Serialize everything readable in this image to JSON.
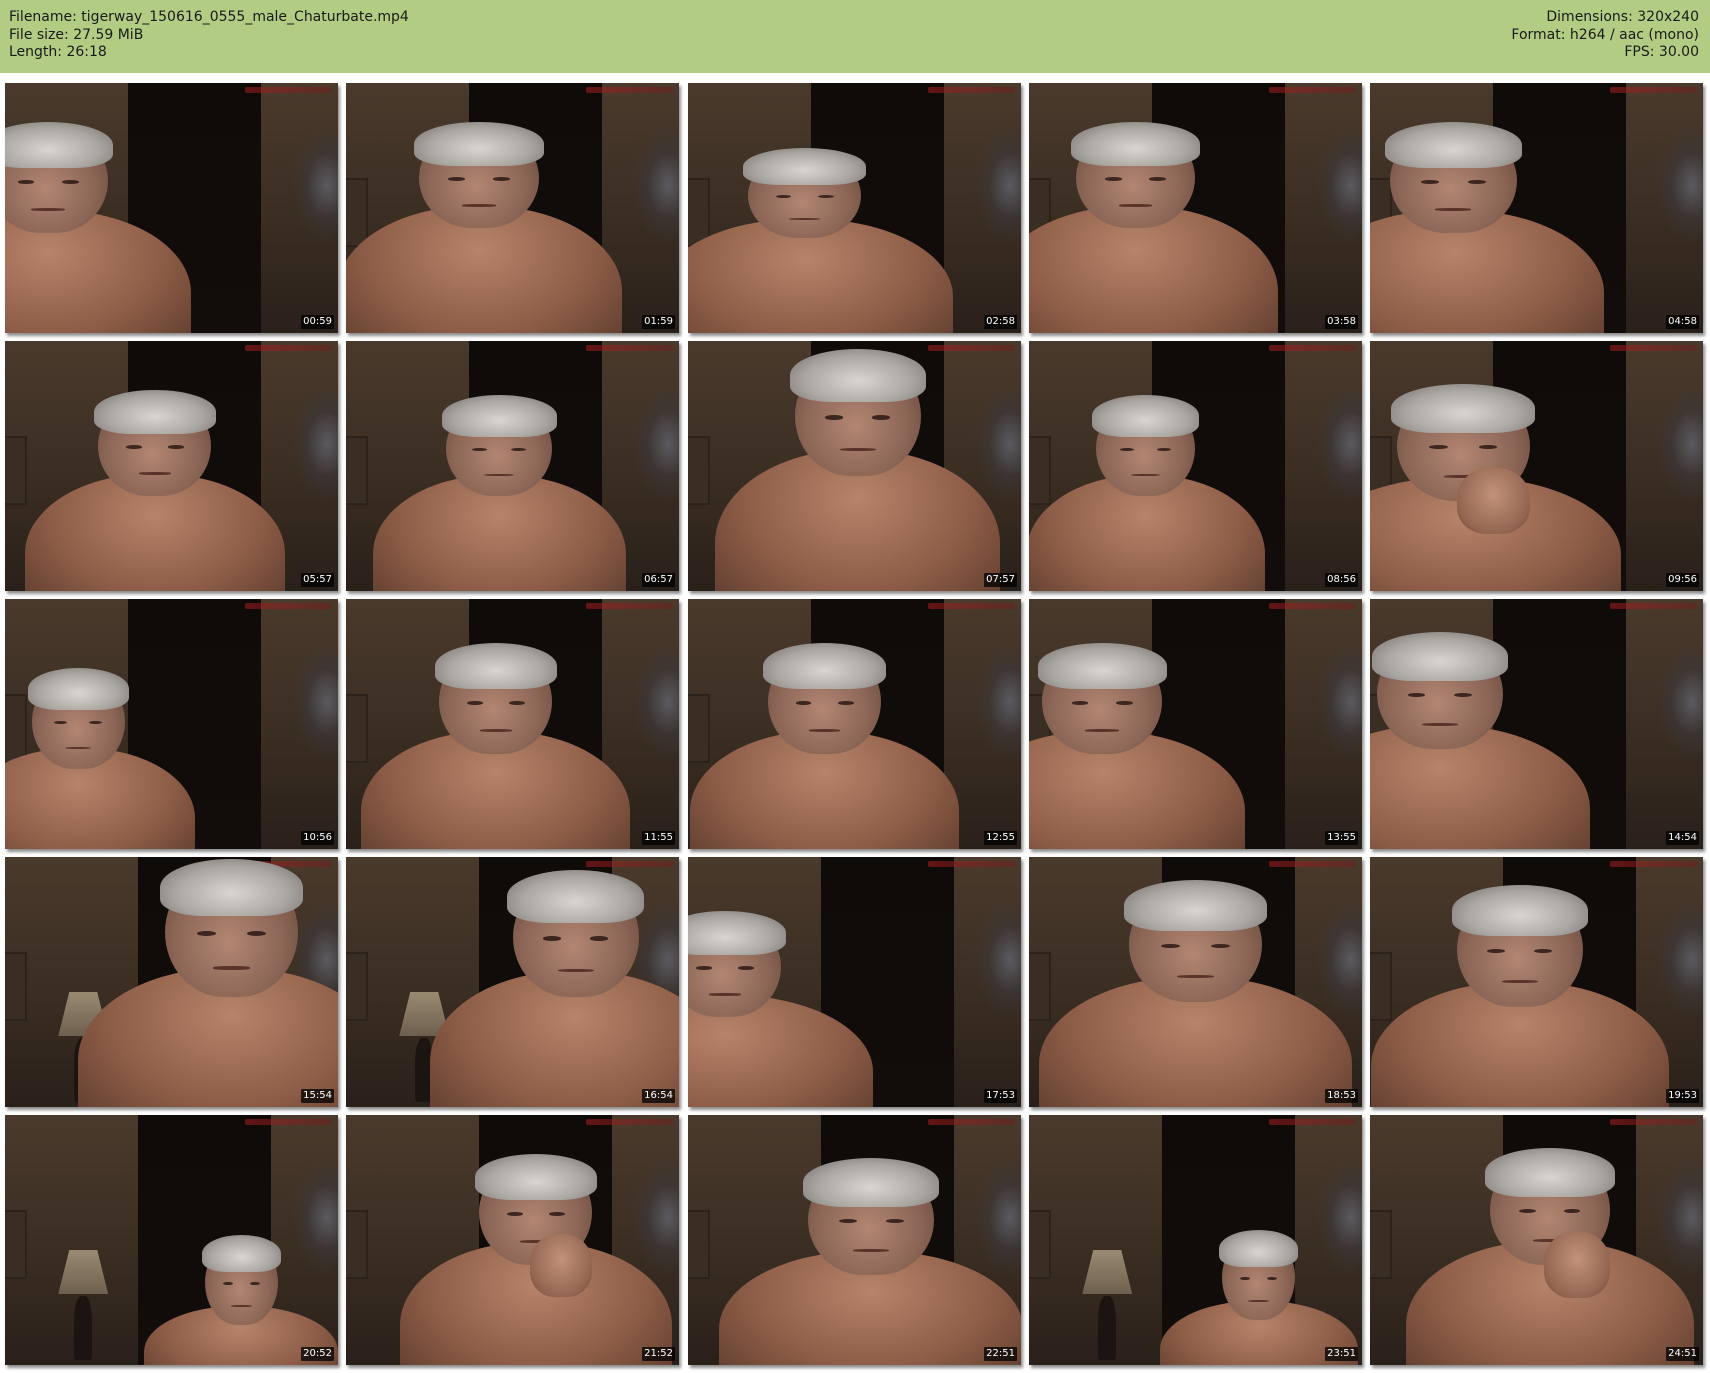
{
  "header": {
    "left_lines": [
      "Filename: tigerway_150616_0555_male_Chaturbate.mp4",
      "File size: 27.59 MiB",
      "Length: 26:18"
    ],
    "right_lines": [
      "Dimensions: 320x240",
      "Format: h264 / aac (mono)",
      "FPS: 30.00"
    ]
  },
  "colors": {
    "header_background": "#b2cd83",
    "page_background": "#ffffff",
    "timestamp_background": "#000000",
    "timestamp_text": "#ffffff"
  },
  "thumbnails": [
    {
      "timestamp": "00:59"
    },
    {
      "timestamp": "01:59"
    },
    {
      "timestamp": "02:58"
    },
    {
      "timestamp": "03:58"
    },
    {
      "timestamp": "04:58"
    },
    {
      "timestamp": "05:57"
    },
    {
      "timestamp": "06:57"
    },
    {
      "timestamp": "07:57"
    },
    {
      "timestamp": "08:56"
    },
    {
      "timestamp": "09:56"
    },
    {
      "timestamp": "10:56"
    },
    {
      "timestamp": "11:55"
    },
    {
      "timestamp": "12:55"
    },
    {
      "timestamp": "13:55"
    },
    {
      "timestamp": "14:54"
    },
    {
      "timestamp": "15:54"
    },
    {
      "timestamp": "16:54"
    },
    {
      "timestamp": "17:53"
    },
    {
      "timestamp": "18:53"
    },
    {
      "timestamp": "19:53"
    },
    {
      "timestamp": "20:52"
    },
    {
      "timestamp": "21:52"
    },
    {
      "timestamp": "22:51"
    },
    {
      "timestamp": "23:51"
    },
    {
      "timestamp": "24:51"
    }
  ]
}
